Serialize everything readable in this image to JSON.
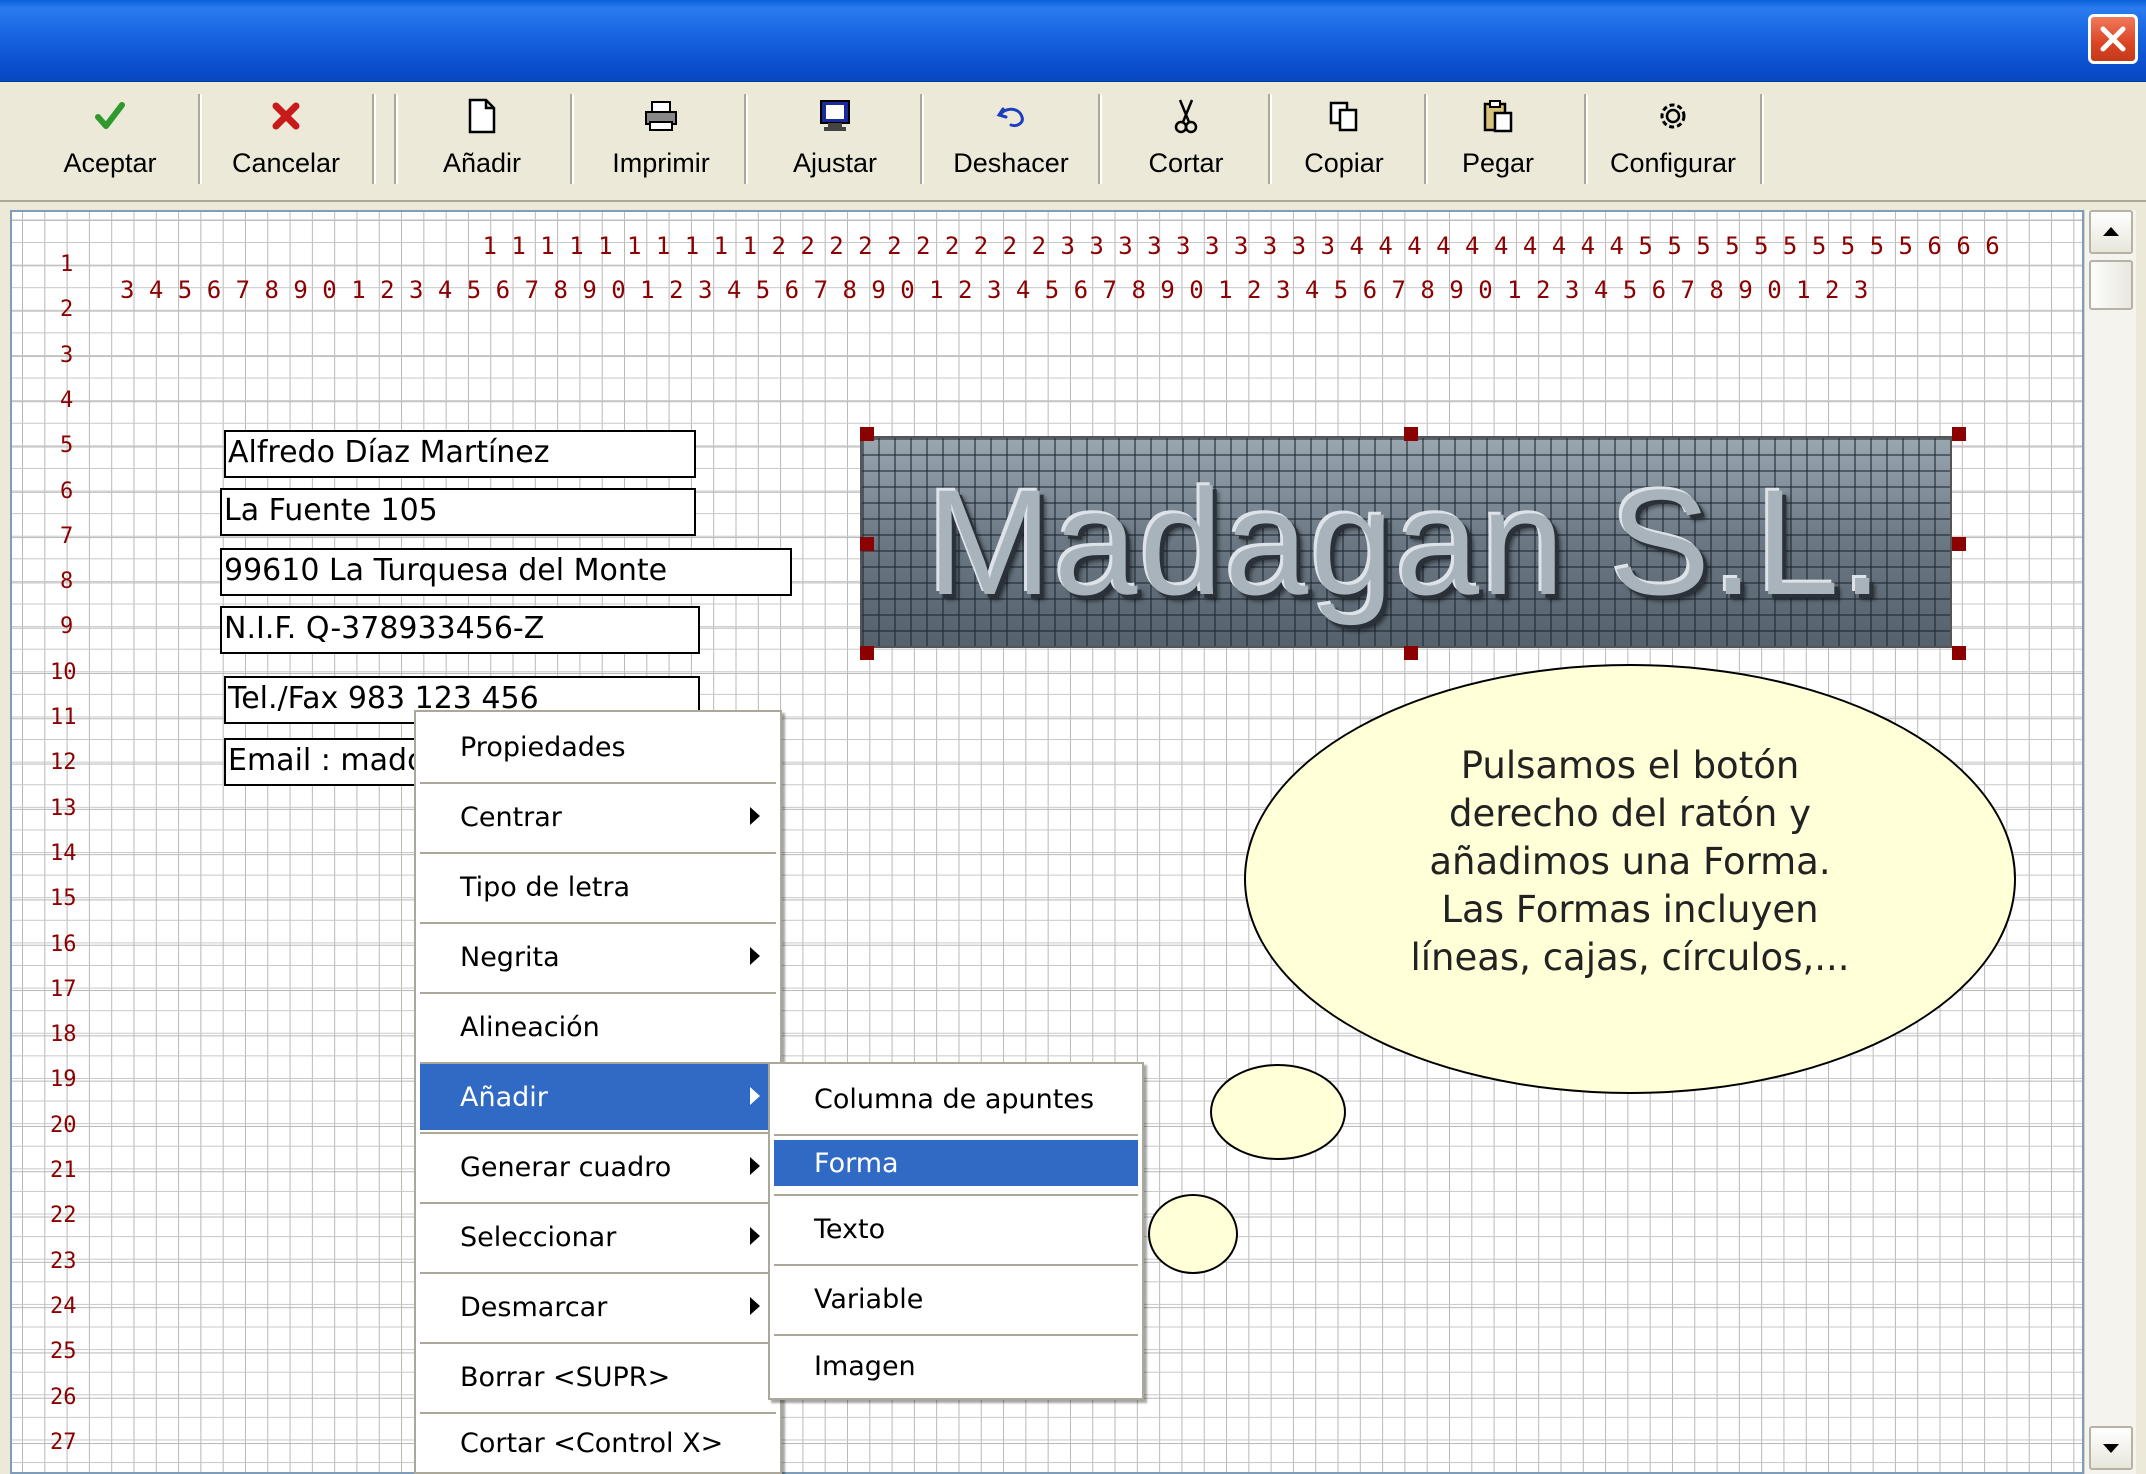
{
  "window": {
    "close_icon": "close-icon"
  },
  "toolbar": {
    "buttons": [
      {
        "label": "Aceptar",
        "icon": "checkmark-icon"
      },
      {
        "label": "Cancelar",
        "icon": "x-mark-icon"
      },
      {
        "label": "Añadir",
        "icon": "new-document-icon"
      },
      {
        "label": "Imprimir",
        "icon": "printer-icon"
      },
      {
        "label": "Ajustar",
        "icon": "monitor-icon"
      },
      {
        "label": "Deshacer",
        "icon": "undo-icon"
      },
      {
        "label": "Cortar",
        "icon": "scissors-icon"
      },
      {
        "label": "Copiar",
        "icon": "copy-icon"
      },
      {
        "label": "Pegar",
        "icon": "paste-icon"
      },
      {
        "label": "Configurar",
        "icon": "gear-icon"
      }
    ]
  },
  "ruler": {
    "tens": "          1 1 1 1 1 1 1 1 1 1 2 2 2 2 2 2 2 2 2 2 3 3 3 3 3 3 3 3 3 3 4 4 4 4 4 4 4 4 4 4 5 5 5 5 5 5 5 5 5 5 6 6 6",
    "units": "3 4 5 6 7 8 9 0 1 2 3 4 5 6 7 8 9 0 1 2 3 4 5 6 7 8 9 0 1 2 3 4 5 6 7 8 9 0 1 2 3 4 5 6 7 8 9 0 1 2 3 4 5 6 7 8 9 0 1 2 3",
    "row_numbers": [
      "1",
      "2",
      "3",
      "4",
      "5",
      "6",
      "7",
      "8",
      "9",
      "10",
      "11",
      "12",
      "13",
      "14",
      "15",
      "16",
      "17",
      "18",
      "19",
      "20",
      "21",
      "22",
      "23",
      "24",
      "25",
      "26",
      "27"
    ]
  },
  "fields": {
    "name": "Alfredo Díaz Martínez",
    "street": "La Fuente 105",
    "city": "99610 La Turquesa del Monte",
    "nif": "N.I.F. Q-378933456-Z",
    "phone": "Tel./Fax 983 123 456",
    "email": "Email : mado"
  },
  "logo": {
    "text": "Madagan S.L."
  },
  "callout": {
    "lines": [
      "Pulsamos el botón",
      "derecho del ratón y",
      "añadimos una Forma.",
      "Las Formas incluyen",
      "líneas, cajas, círculos,..."
    ]
  },
  "context_menu": {
    "items": [
      {
        "label": "Propiedades",
        "submenu": false
      },
      {
        "label": "Centrar",
        "submenu": true
      },
      {
        "label": "Tipo de letra",
        "submenu": false
      },
      {
        "label": "Negrita",
        "submenu": true
      },
      {
        "label": "Alineación",
        "submenu": false
      },
      {
        "label": "Añadir",
        "submenu": true,
        "selected": true
      },
      {
        "label": "Generar cuadro",
        "submenu": true
      },
      {
        "label": "Seleccionar",
        "submenu": true
      },
      {
        "label": "Desmarcar",
        "submenu": true
      },
      {
        "label": "Borrar <SUPR>",
        "submenu": false
      },
      {
        "label": "Cortar <Control X>",
        "submenu": false
      }
    ]
  },
  "submenu": {
    "items": [
      {
        "label": "Columna de apuntes"
      },
      {
        "label": "Forma",
        "selected": true
      },
      {
        "label": "Texto"
      },
      {
        "label": "Variable"
      },
      {
        "label": "Imagen"
      }
    ]
  },
  "colors": {
    "accent": "#316AC5",
    "ruler": "#8B0000",
    "callout_fill": "#FFFFD8",
    "titlebar": "#0B4FCF"
  }
}
